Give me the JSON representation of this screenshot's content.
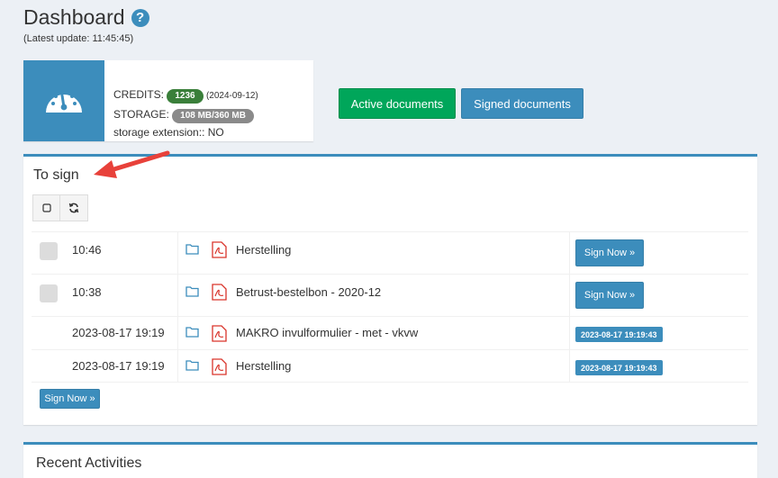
{
  "header": {
    "title": "Dashboard",
    "help_icon": "?",
    "last_update": "(Latest update: 11:45:45)"
  },
  "info": {
    "credits_label": "CREDITS:",
    "credits_value": "1236",
    "credits_date": "(2024-09-12)",
    "storage_label": "STORAGE:",
    "storage_value": "108 MB/360 MB",
    "extension_label": "storage extension:: NO"
  },
  "buttons": {
    "active": "Active documents",
    "signed": "Signed documents"
  },
  "to_sign": {
    "title": "To sign",
    "rows": [
      {
        "time": "10:46",
        "name": "Herstelling",
        "action": "Sign Now »"
      },
      {
        "time": "10:38",
        "name": "Betrust-bestelbon - 2020-12",
        "action": "Sign Now »"
      },
      {
        "time": "2023-08-17 19:19",
        "name": "MAKRO invulformulier - met - vkvw",
        "signed_at": "2023-08-17 19:19:43"
      },
      {
        "time": "2023-08-17 19:19",
        "name": "Herstelling",
        "signed_at": "2023-08-17 19:19:43"
      }
    ],
    "bulk_action": "Sign Now »"
  },
  "recent": {
    "title": "Recent Activities"
  },
  "colors": {
    "primary": "#3c8dbc",
    "success": "#00a65a",
    "pdf_red": "#d9342b",
    "arrow": "#e8413a"
  }
}
